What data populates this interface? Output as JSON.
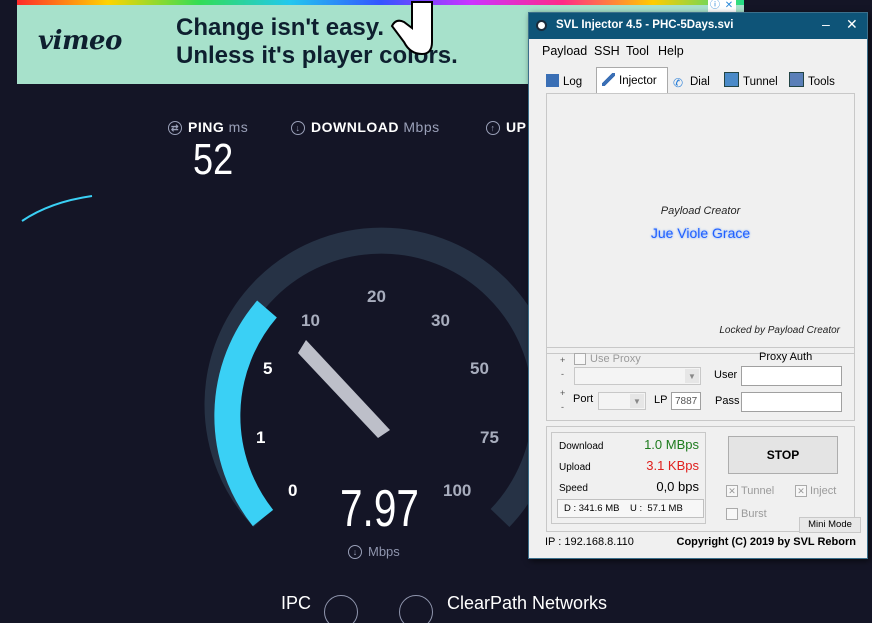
{
  "ad": {
    "brand": "vimeo",
    "headline_line1": "Change isn't easy.",
    "headline_line2": "Unless it's player colors.",
    "info_icon": "ⓘ",
    "close_icon": "✕",
    "cursor_icon": "hand-pointer-icon"
  },
  "speedtest": {
    "ping_label": "PING",
    "ping_unit": "ms",
    "ping_value": "52",
    "download_label": "DOWNLOAD",
    "download_unit": "Mbps",
    "upload_label": "UP",
    "gauge_ticks": [
      "0",
      "1",
      "5",
      "10",
      "20",
      "30",
      "50",
      "75",
      "100"
    ],
    "speed_value": "7.97",
    "speed_unit": "Mbps",
    "isp_name": "IPC",
    "server_name": "ClearPath Networks",
    "accent_color": "#3ad0f5"
  },
  "injector": {
    "title": "SVL Injector 4.5 - PHC-5Days.svi",
    "minimize_icon": "–",
    "close_icon": "✕",
    "menu": [
      "Payload",
      "SSH",
      "Tool",
      "Help"
    ],
    "tabs": [
      {
        "label": "Log",
        "icon": "log-icon"
      },
      {
        "label": "Injector",
        "icon": "syringe-icon"
      },
      {
        "label": "Dial",
        "icon": "phone-icon"
      },
      {
        "label": "Tunnel",
        "icon": "tunnel-icon"
      },
      {
        "label": "Tools",
        "icon": "tools-icon"
      }
    ],
    "active_tab": "Injector",
    "payload_creator_label": "Payload Creator",
    "payload_creator_name": "Jue Viole Grace",
    "locked_text": "Locked by Payload Creator",
    "proxy": {
      "use_proxy_label": "Use Proxy",
      "proxy_auth_label": "Proxy Auth",
      "user_label": "User",
      "pass_label": "Pass",
      "port_label": "Port",
      "lp_label": "LP",
      "lp_value": "7887",
      "plus": "+",
      "minus": "-"
    },
    "stats": {
      "download_label": "Download",
      "download_value": "1.0 MBps",
      "upload_label": "Upload",
      "upload_value": "3.1 KBps",
      "speed_label": "Speed",
      "speed_value": "0,0 bps",
      "summary": "D : 341.6 MB    U :  57.1 MB",
      "download_color": "#1e7b1e",
      "upload_color": "#e0201e"
    },
    "stop_label": "STOP",
    "tunnel_label": "Tunnel",
    "inject_label": "Inject",
    "burst_label": "Burst",
    "mini_mode_label": "Mini Mode",
    "ip_text": "IP : 192.168.8.110",
    "copyright": "Copyright (C) 2019 by SVL Reborn"
  }
}
